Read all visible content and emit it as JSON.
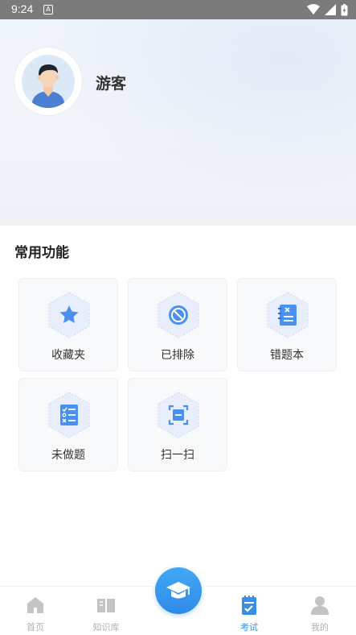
{
  "status": {
    "time": "9:24",
    "a_badge": "A"
  },
  "profile": {
    "name": "游客"
  },
  "section": {
    "title": "常用功能"
  },
  "features": [
    {
      "label": "收藏夹",
      "icon": "star-icon"
    },
    {
      "label": "已排除",
      "icon": "ban-icon"
    },
    {
      "label": "错题本",
      "icon": "notebook-icon"
    },
    {
      "label": "未做题",
      "icon": "checklist-icon"
    },
    {
      "label": "扫一扫",
      "icon": "scan-icon"
    }
  ],
  "tabs": [
    {
      "label": "首页",
      "icon": "home-icon",
      "active": false
    },
    {
      "label": "知识库",
      "icon": "book-icon",
      "active": false
    },
    {
      "label": "考试",
      "icon": "exam-clipboard-icon",
      "active": true
    },
    {
      "label": "我的",
      "icon": "user-icon",
      "active": false
    }
  ],
  "fab": {
    "icon": "graduation-cap-icon"
  },
  "colors": {
    "accent": "#3a8ee6",
    "icon_blue": "#4a90f0",
    "inactive": "#b0b0b0"
  }
}
